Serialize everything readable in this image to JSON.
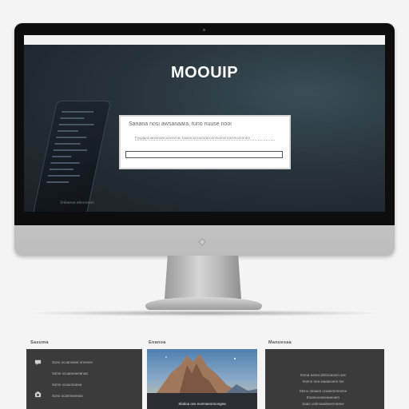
{
  "screen": {
    "brand": "MOOUIP",
    "dialog": {
      "title": "Sanana nosi awsanaara, tuno nuuse nooi",
      "subtitle": "Fyygapunamanaeroononmer baatonoocainaaccenmamnrrneemoonrntre",
      "input_value": ""
    },
    "phone_caption": "Snkaesa ekerosres"
  },
  "thumbnails": [
    {
      "label": "Sasuma",
      "lines": [
        "Sons ocuamaeai nmnees",
        "Ssms  ocuaeeaeeanaa",
        "Ssms ocauonaeaa",
        "Sono  ocammeenas"
      ],
      "icons": [
        "chat-icon",
        "camera-icon"
      ]
    },
    {
      "label": "Enanoa",
      "caption": "Skaloa oss eunmaeonnosgea"
    },
    {
      "label": "Manuesaa",
      "paragraph": [
        "Snma eama dmtnoaonm anc",
        "Ssnnn mra waaasoem tse",
        "Skmo oinaam ccaanmmneme",
        "Esaneoeaseaaeuam",
        "Saao usbmaadeaecneane"
      ]
    }
  ],
  "colors": {
    "screen_bg": "#27333b",
    "bezel": "#0d0d0d",
    "thumb_bg": "#3b3b3b"
  }
}
